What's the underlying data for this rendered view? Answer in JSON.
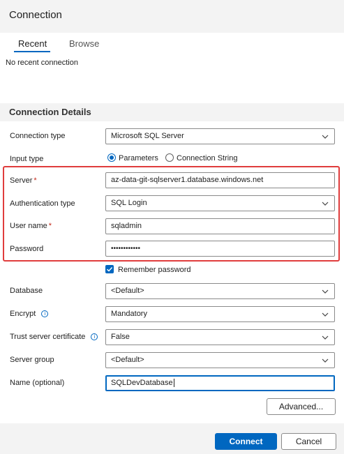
{
  "dialog": {
    "title": "Connection"
  },
  "tabs": [
    {
      "label": "Recent",
      "active": true
    },
    {
      "label": "Browse",
      "active": false
    }
  ],
  "recent": {
    "empty_text": "No recent connection"
  },
  "details": {
    "section_title": "Connection Details",
    "connection_type": {
      "label": "Connection type",
      "value": "Microsoft SQL Server"
    },
    "input_type": {
      "label": "Input type",
      "options": [
        "Parameters",
        "Connection String"
      ],
      "selected": "Parameters"
    },
    "server": {
      "label": "Server",
      "required_mark": "*",
      "value": "az-data-git-sqlserver1.database.windows.net"
    },
    "authentication_type": {
      "label": "Authentication type",
      "value": "SQL Login"
    },
    "user_name": {
      "label": "User name",
      "required_mark": "*",
      "value": "sqladmin"
    },
    "password": {
      "label": "Password",
      "value": "••••••••••••"
    },
    "remember_password": {
      "label": "Remember password",
      "checked": true
    },
    "database": {
      "label": "Database",
      "value": "<Default>"
    },
    "encrypt": {
      "label": "Encrypt",
      "value": "Mandatory"
    },
    "trust_server_certificate": {
      "label": "Trust server certificate",
      "value": "False"
    },
    "server_group": {
      "label": "Server group",
      "value": "<Default>"
    },
    "name_optional": {
      "label": "Name (optional)",
      "value": "SQLDevDatabase"
    },
    "advanced_label": "Advanced..."
  },
  "footer": {
    "connect_label": "Connect",
    "cancel_label": "Cancel"
  },
  "colors": {
    "accent": "#0067c0",
    "highlight_border": "#e03c3c",
    "required": "#c42b1c"
  },
  "icons": {
    "dropdown": "chevron-down-icon",
    "info": "info-icon",
    "check": "checkmark-icon"
  }
}
